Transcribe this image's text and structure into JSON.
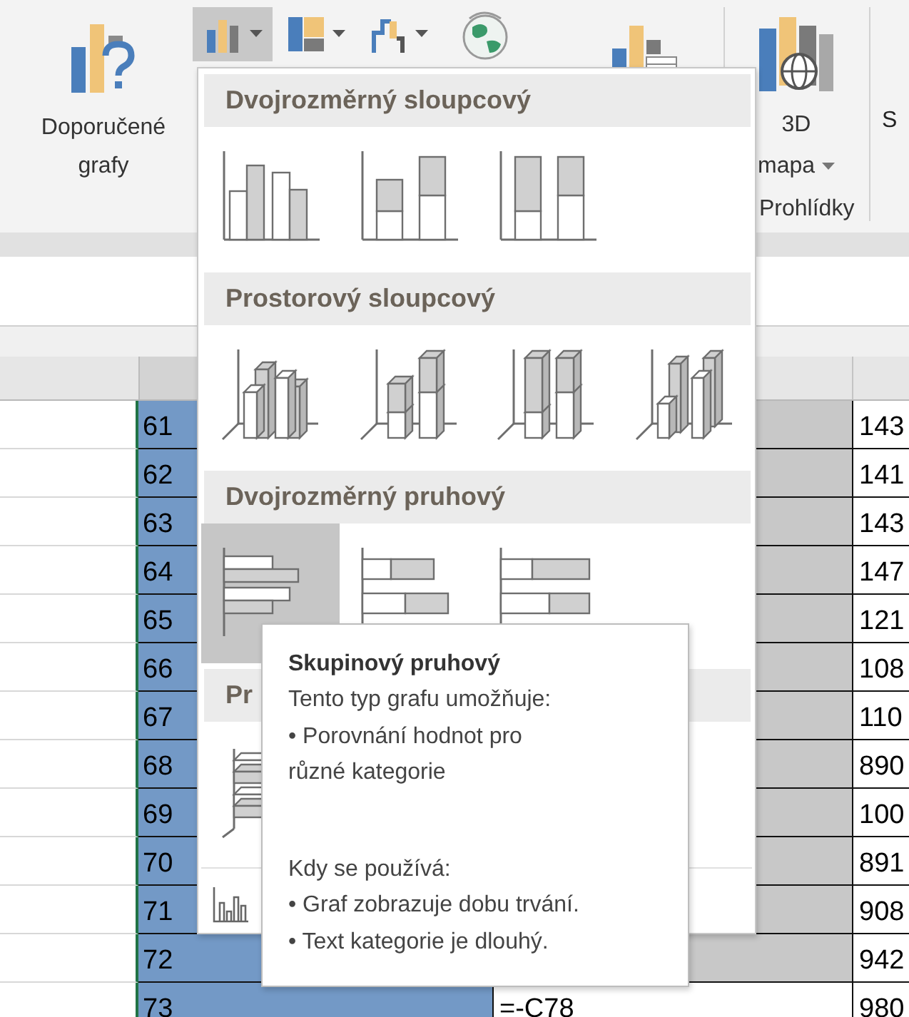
{
  "ribbon": {
    "recommended": {
      "lines": [
        "Doporučené",
        "grafy"
      ]
    },
    "chart_buttons": [
      {
        "kind": "column",
        "selected": true
      },
      {
        "kind": "hierarchy",
        "selected": false
      },
      {
        "kind": "waterfall",
        "selected": false
      }
    ],
    "map3d": {
      "lines": [
        "3D",
        "mapa"
      ]
    },
    "group_label": "Prohlídky",
    "cut_label": "S"
  },
  "sheet": {
    "rows": [
      {
        "number": "61",
        "col_c": "",
        "shaded": true,
        "col_d": "143"
      },
      {
        "number": "62",
        "col_c": "",
        "shaded": true,
        "col_d": "141"
      },
      {
        "number": "63",
        "col_c": "",
        "shaded": true,
        "col_d": "143"
      },
      {
        "number": "64",
        "col_c": "",
        "shaded": true,
        "col_d": "147"
      },
      {
        "number": "65",
        "col_c": "",
        "shaded": true,
        "col_d": "121"
      },
      {
        "number": "66",
        "col_c": "",
        "shaded": true,
        "col_d": "108"
      },
      {
        "number": "67",
        "col_c": "",
        "shaded": true,
        "col_d": "110"
      },
      {
        "number": "68",
        "col_c": "",
        "shaded": true,
        "col_d": "890"
      },
      {
        "number": "69",
        "col_c": "",
        "shaded": true,
        "col_d": "100"
      },
      {
        "number": "70",
        "col_c": "",
        "shaded": true,
        "col_d": "891"
      },
      {
        "number": "71",
        "col_c": "",
        "shaded": true,
        "col_d": "908"
      },
      {
        "number": "72",
        "col_c": "",
        "shaded": true,
        "col_d": "942"
      },
      {
        "number": "73",
        "col_c": "=-C78",
        "shaded": false,
        "col_d": "980"
      }
    ]
  },
  "menu": {
    "sections": [
      {
        "title": "Dvojrozměrný sloupcový",
        "items": [
          {
            "kind": "clustered",
            "selected": false
          },
          {
            "kind": "stacked",
            "selected": false
          },
          {
            "kind": "percent",
            "selected": false
          }
        ]
      },
      {
        "title": "Prostorový sloupcový",
        "items": [
          {
            "kind": "clustered3d",
            "selected": false
          },
          {
            "kind": "stacked3d",
            "selected": false
          },
          {
            "kind": "percent3d",
            "selected": false
          },
          {
            "kind": "column3d",
            "selected": false
          }
        ]
      },
      {
        "title": "Dvojrozměrný pruhový",
        "items": [
          {
            "kind": "bar",
            "selected": true
          },
          {
            "kind": "stackedbar",
            "selected": false
          },
          {
            "kind": "percentbar",
            "selected": false
          }
        ]
      },
      {
        "title": "Pr",
        "items": [
          {
            "kind": "bar3d",
            "selected": false
          }
        ]
      }
    ]
  },
  "tooltip": {
    "title": "Skupinový pruhový",
    "paragraphs": [
      [
        "Tento typ grafu umožňuje:",
        "• Porovnání hodnot pro",
        "různé kategorie"
      ],
      [
        "Kdy se používá:",
        "• Graf zobrazuje dobu trvání.",
        "• Text kategorie je dlouhý."
      ]
    ]
  }
}
